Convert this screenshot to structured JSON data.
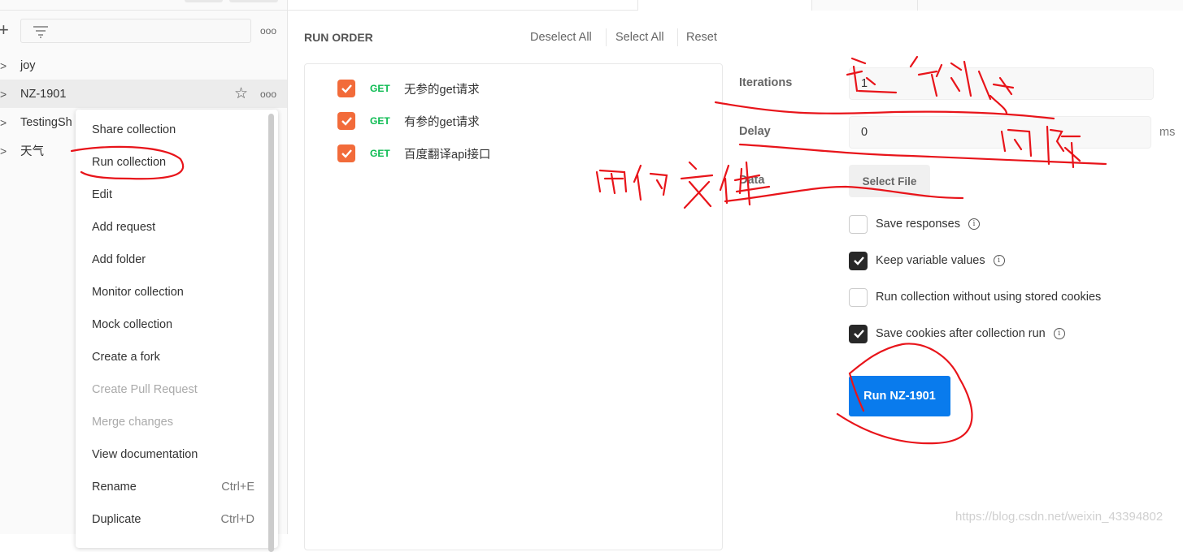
{
  "sidebar": {
    "collections": [
      {
        "name": "joy"
      },
      {
        "name": "NZ-1901",
        "selected": true
      },
      {
        "name": "TestingSh"
      },
      {
        "name": "天气"
      }
    ],
    "icons": {
      "add": "plus-icon",
      "filter": "filter-icon",
      "more": "more-dots-icon",
      "favorite": "star-icon",
      "expand": "chevron-right-icon"
    }
  },
  "context_menu": {
    "items": [
      {
        "label": "Share collection",
        "shortcut": "",
        "disabled": false
      },
      {
        "label": "Run collection",
        "shortcut": "",
        "disabled": false
      },
      {
        "label": "Edit",
        "shortcut": "",
        "disabled": false
      },
      {
        "label": "Add request",
        "shortcut": "",
        "disabled": false
      },
      {
        "label": "Add folder",
        "shortcut": "",
        "disabled": false
      },
      {
        "label": "Monitor collection",
        "shortcut": "",
        "disabled": false
      },
      {
        "label": "Mock collection",
        "shortcut": "",
        "disabled": false
      },
      {
        "label": "Create a fork",
        "shortcut": "",
        "disabled": false
      },
      {
        "label": "Create Pull Request",
        "shortcut": "",
        "disabled": true
      },
      {
        "label": "Merge changes",
        "shortcut": "",
        "disabled": true
      },
      {
        "label": "View documentation",
        "shortcut": "",
        "disabled": false
      },
      {
        "label": "Rename",
        "shortcut": "Ctrl+E",
        "disabled": false
      },
      {
        "label": "Duplicate",
        "shortcut": "Ctrl+D",
        "disabled": false
      }
    ]
  },
  "run_order": {
    "title": "RUN ORDER",
    "deselect_all": "Deselect All",
    "select_all": "Select All",
    "reset": "Reset",
    "requests": [
      {
        "method": "GET",
        "name": "无参的get请求",
        "checked": true
      },
      {
        "method": "GET",
        "name": "有参的get请求",
        "checked": true
      },
      {
        "method": "GET",
        "name": "百度翻译api接口",
        "checked": true
      }
    ]
  },
  "settings": {
    "iterations_label": "Iterations",
    "iterations_value": "1",
    "delay_label": "Delay",
    "delay_value": "0",
    "delay_unit": "ms",
    "data_label": "Data",
    "select_file": "Select File",
    "options": [
      {
        "label": "Save responses",
        "checked": false,
        "info": true
      },
      {
        "label": "Keep variable values",
        "checked": true,
        "info": true
      },
      {
        "label": "Run collection without using stored cookies",
        "checked": false,
        "info": false
      },
      {
        "label": "Save cookies after collection run",
        "checked": true,
        "info": true
      }
    ],
    "run_button": "Run NZ-1901"
  },
  "annotations": {
    "iterations_note": "运行次数",
    "delay_note": "间隔",
    "data_note": "用例文件",
    "color": "#e8141a"
  },
  "watermark": "https://blog.csdn.net/weixin_43394802",
  "colors": {
    "accent": "#097bed",
    "checkbox": "#f26b3a",
    "get": "#0cbb52"
  }
}
